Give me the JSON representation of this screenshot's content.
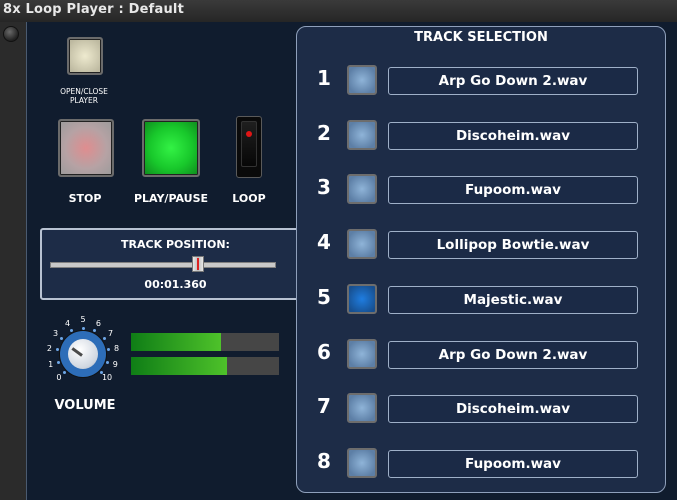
{
  "window": {
    "title": "8x Loop Player : Default"
  },
  "controls": {
    "open_close_label": "OPEN/CLOSE PLAYER",
    "stop_label": "STOP",
    "play_pause_label": "PLAY/PAUSE",
    "loop_label": "LOOP"
  },
  "track_position": {
    "heading": "TRACK POSITION:",
    "time": "00:01.360",
    "fraction": 0.67
  },
  "volume": {
    "label": "VOLUME",
    "scale": [
      "0",
      "1",
      "2",
      "3",
      "4",
      "5",
      "6",
      "7",
      "8",
      "9",
      "10"
    ],
    "level": 3
  },
  "meters": {
    "left": 0.61,
    "right": 0.65,
    "color": "#3fb52a"
  },
  "track_selection": {
    "heading": "TRACK SELECTION",
    "active_index": 5,
    "tracks": [
      {
        "num": "1",
        "name": "Arp Go Down 2.wav"
      },
      {
        "num": "2",
        "name": "Discoheim.wav"
      },
      {
        "num": "3",
        "name": "Fupoom.wav"
      },
      {
        "num": "4",
        "name": "Lollipop Bowtie.wav"
      },
      {
        "num": "5",
        "name": "Majestic.wav"
      },
      {
        "num": "6",
        "name": "Arp Go Down 2.wav"
      },
      {
        "num": "7",
        "name": "Discoheim.wav"
      },
      {
        "num": "8",
        "name": "Fupoom.wav"
      }
    ]
  },
  "colors": {
    "panel": "#101c2e",
    "accent": "#1f7de0",
    "play_led": "#22d33a",
    "stop_led": "#d88a8a"
  }
}
